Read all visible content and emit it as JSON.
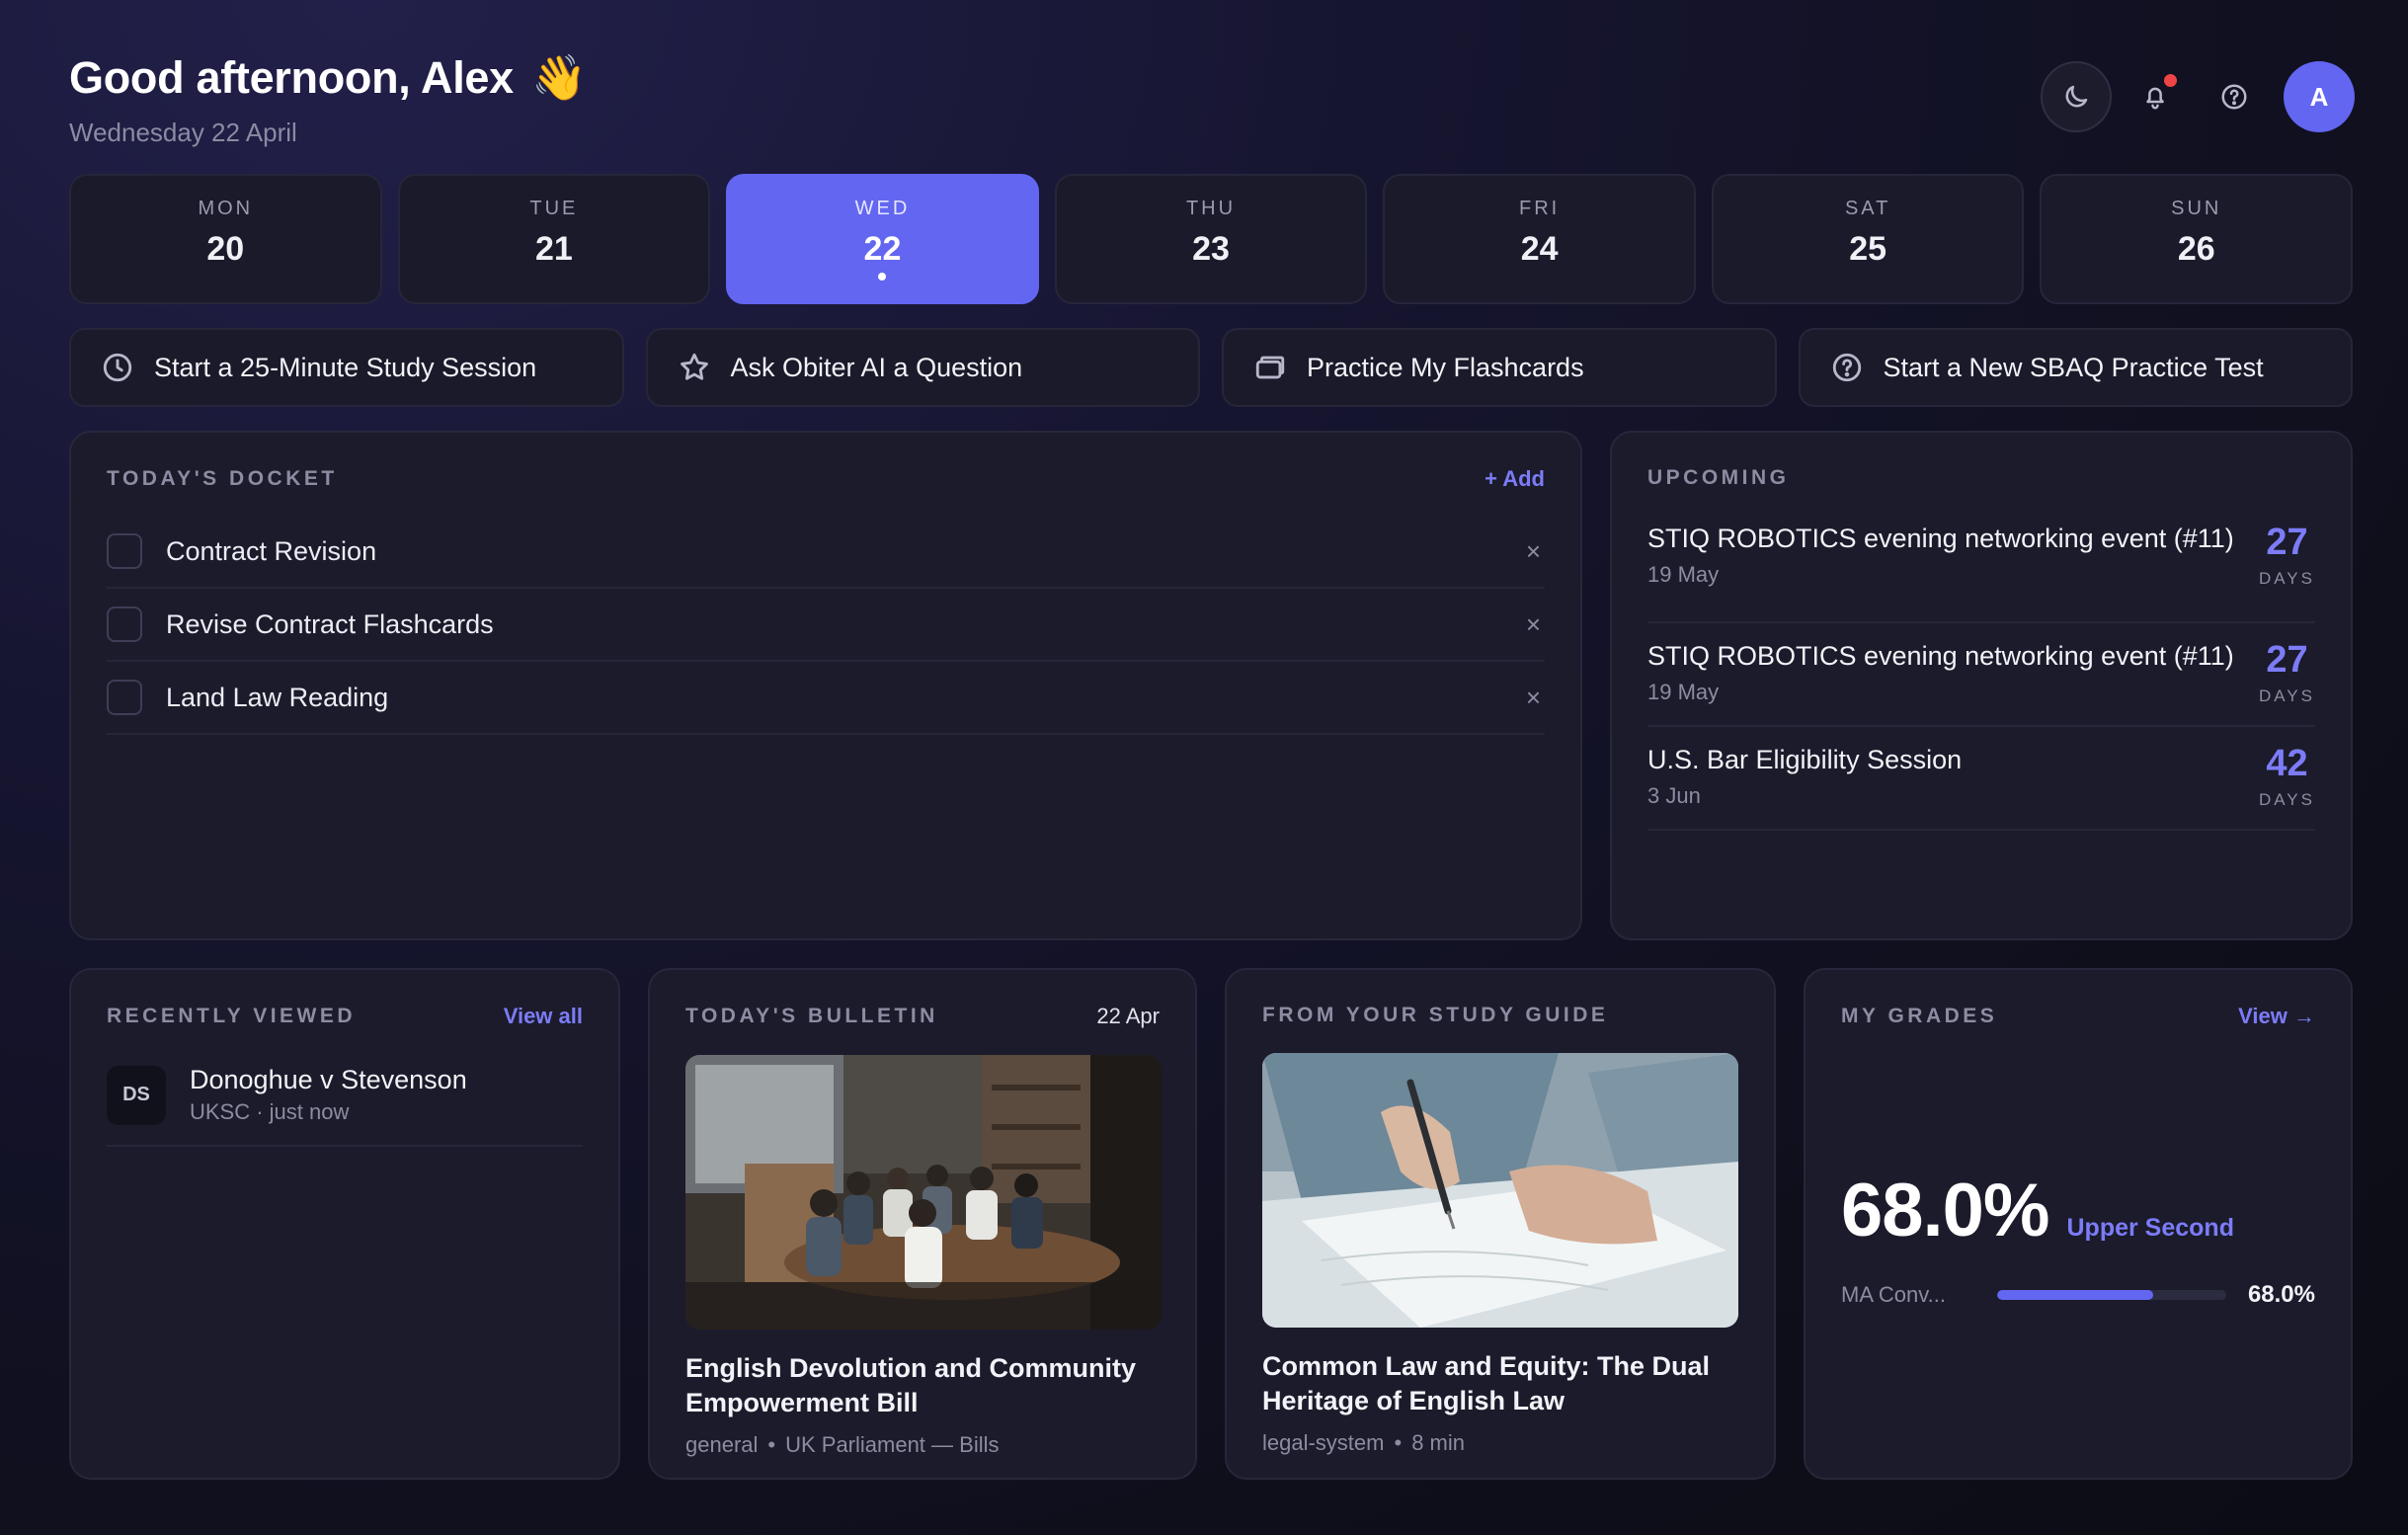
{
  "header": {
    "greeting": "Good afternoon, Alex",
    "wave": "👋",
    "date": "Wednesday 22 April",
    "avatar_initial": "A"
  },
  "week": [
    {
      "name": "MON",
      "num": "20"
    },
    {
      "name": "TUE",
      "num": "21"
    },
    {
      "name": "WED",
      "num": "22",
      "active": true
    },
    {
      "name": "THU",
      "num": "23"
    },
    {
      "name": "FRI",
      "num": "24"
    },
    {
      "name": "SAT",
      "num": "25"
    },
    {
      "name": "SUN",
      "num": "26"
    }
  ],
  "actions": [
    {
      "label": "Start a 25-Minute Study Session",
      "icon": "clock-icon"
    },
    {
      "label": "Ask Obiter AI a Question",
      "icon": "star-icon"
    },
    {
      "label": "Practice My Flashcards",
      "icon": "cards-icon"
    },
    {
      "label": "Start a New SBAQ Practice Test",
      "icon": "question-circle-icon"
    }
  ],
  "docket": {
    "title": "TODAY'S DOCKET",
    "add_label": "+ Add",
    "items": [
      {
        "text": "Contract Revision"
      },
      {
        "text": "Revise Contract Flashcards"
      },
      {
        "text": "Land Law Reading"
      }
    ],
    "remove_glyph": "×"
  },
  "upcoming": {
    "title": "UPCOMING",
    "items": [
      {
        "name": "STIQ ROBOTICS evening networking event (#11)",
        "date": "19 May",
        "days": "27",
        "unit": "DAYS"
      },
      {
        "name": "STIQ ROBOTICS evening networking event (#11)",
        "date": "19 May",
        "days": "27",
        "unit": "DAYS"
      },
      {
        "name": "U.S. Bar Eligibility Session",
        "date": "3 Jun",
        "days": "42",
        "unit": "DAYS"
      }
    ]
  },
  "recent": {
    "title": "RECENTLY VIEWED",
    "view_all": "View all",
    "items": [
      {
        "initials": "DS",
        "title": "Donoghue v Stevenson",
        "sub": "UKSC · just now"
      }
    ]
  },
  "bulletin": {
    "title": "TODAY'S BULLETIN",
    "date": "22 Apr",
    "article_title": "English Devolution and Community Empowerment Bill",
    "tag": "general",
    "source": "UK Parliament — Bills"
  },
  "guide": {
    "title": "FROM YOUR STUDY GUIDE",
    "article_title": "Common Law and Equity: The Dual Heritage of English Law",
    "tag": "legal-system",
    "read_time": "8 min"
  },
  "grades": {
    "title": "MY GRADES",
    "view_label": "View →",
    "overall": "68.0%",
    "classification": "Upper Second",
    "modules": [
      {
        "label": "MA Conv...",
        "value": "68.0%",
        "fraction": 0.68
      }
    ]
  },
  "colors": {
    "accent": "#6366f1",
    "accent_text": "#7c7cf8",
    "notification": "#ef4444"
  }
}
